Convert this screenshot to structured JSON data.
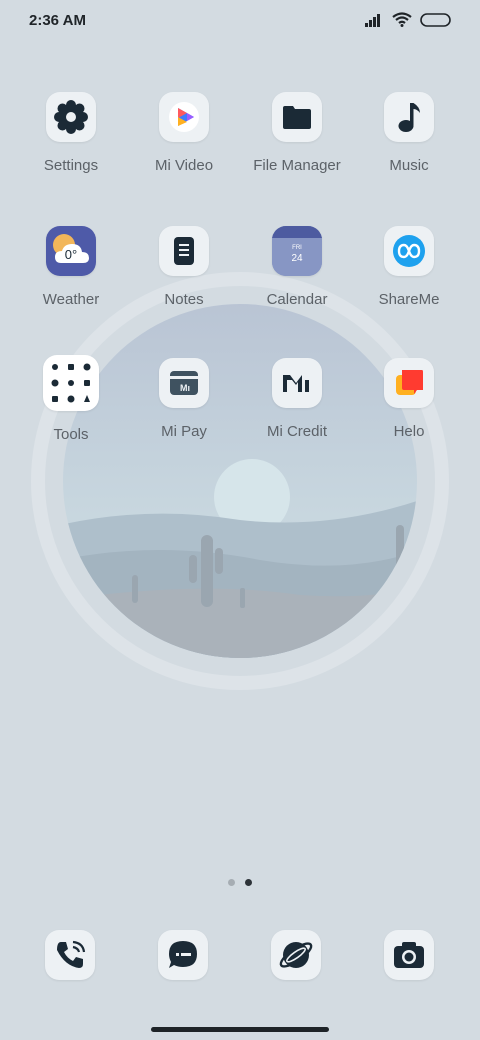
{
  "status_bar": {
    "time": "2:36 AM",
    "icons": [
      "signal-icon",
      "wifi-icon",
      "battery-icon"
    ]
  },
  "grid": {
    "row1": [
      {
        "label": "Settings",
        "icon": "settings-icon"
      },
      {
        "label": "Mi Video",
        "icon": "mi-video-icon"
      },
      {
        "label": "File Manager",
        "icon": "folder-icon"
      },
      {
        "label": "Music",
        "icon": "music-note-icon"
      }
    ],
    "row2": [
      {
        "label": "Weather",
        "icon": "weather-icon",
        "temperature": "0°"
      },
      {
        "label": "Notes",
        "icon": "notes-icon"
      },
      {
        "label": "Calendar",
        "icon": "calendar-icon",
        "weekday": "FRI",
        "day": "24"
      },
      {
        "label": "ShareMe",
        "icon": "shareme-icon"
      }
    ],
    "row3": [
      {
        "label": "Tools",
        "icon": "tools-folder-icon"
      },
      {
        "label": "Mi Pay",
        "icon": "mi-pay-icon"
      },
      {
        "label": "Mi Credit",
        "icon": "mi-credit-icon"
      },
      {
        "label": "Helo",
        "icon": "helo-icon"
      }
    ]
  },
  "page_indicator": {
    "pages": 2,
    "active": 2
  },
  "dock": [
    "phone-icon",
    "messages-icon",
    "browser-icon",
    "camera-icon"
  ],
  "colors": {
    "background": "#d3dbe1",
    "tile": "#edf1f4",
    "icon_dark": "#1b2a36",
    "label": "#5c6268"
  }
}
